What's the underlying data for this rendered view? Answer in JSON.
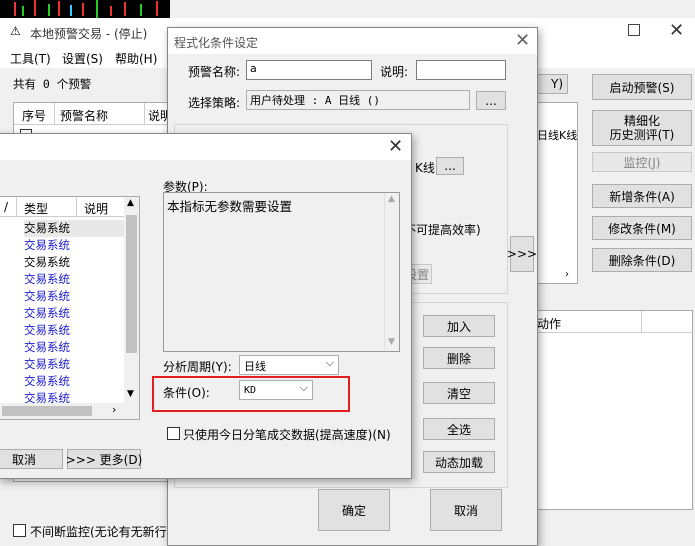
{
  "main_window": {
    "title": "本地预警交易 - (停止)",
    "menu": [
      "工具(T)",
      "设置(S)",
      "帮助(H)"
    ],
    "count_text": "共有 0 个预警",
    "columns": [
      "序号",
      "预警名称",
      "说明"
    ],
    "partial_button": "Y)",
    "partial_cols": [
      "日线",
      "K线"
    ],
    "partial_action_col": "动作",
    "side_buttons": {
      "start": "启动预警(S)",
      "refine_line1": "精细化",
      "refine_line2": "历史测评(T)",
      "monitor": "监控(J)",
      "add": "新增条件(A)",
      "modify": "修改条件(M)",
      "delete": "删除条件(D)"
    },
    "continuous_monitor": "不间断监控(无论有无新行"
  },
  "cond_dialog": {
    "title": "程式化条件设定",
    "alert_name_label": "预警名称:",
    "alert_name_value": "a",
    "desc_label": "说明:",
    "desc_value": "",
    "strategy_label": "选择策略:",
    "strategy_value": "用户待处理 : A 日线 ()",
    "ellipsis": "...",
    "partial_kline": "K线",
    "partial_efficiency": "不可提高效率)",
    "arrow_btn": ">>>",
    "partial_settings": "设置",
    "buttons": {
      "add": "加入",
      "delete": "删除",
      "clear": "清空",
      "select_all": "全选",
      "dynamic_load": "动态加载",
      "ok": "确定",
      "cancel": "取消"
    }
  },
  "indicator_dialog": {
    "columns": [
      "/",
      "类型",
      "说明"
    ],
    "rows": [
      "交易系统",
      "交易系统",
      "交易系统",
      "交易系统",
      "交易系统",
      "交易系统",
      "交易系统",
      "交易系统",
      "交易系统",
      "交易系统",
      "交易系统"
    ],
    "params_label": "参数(P):",
    "params_text": "本指标无参数需要设置",
    "period_label": "分析周期(Y):",
    "period_value": "日线",
    "condition_label": "条件(O):",
    "condition_value": "KD",
    "checkbox_label": "只使用今日分笔成交数据(提高速度)(N)",
    "cancel": "取消",
    "more": ">>> 更多(D)"
  }
}
